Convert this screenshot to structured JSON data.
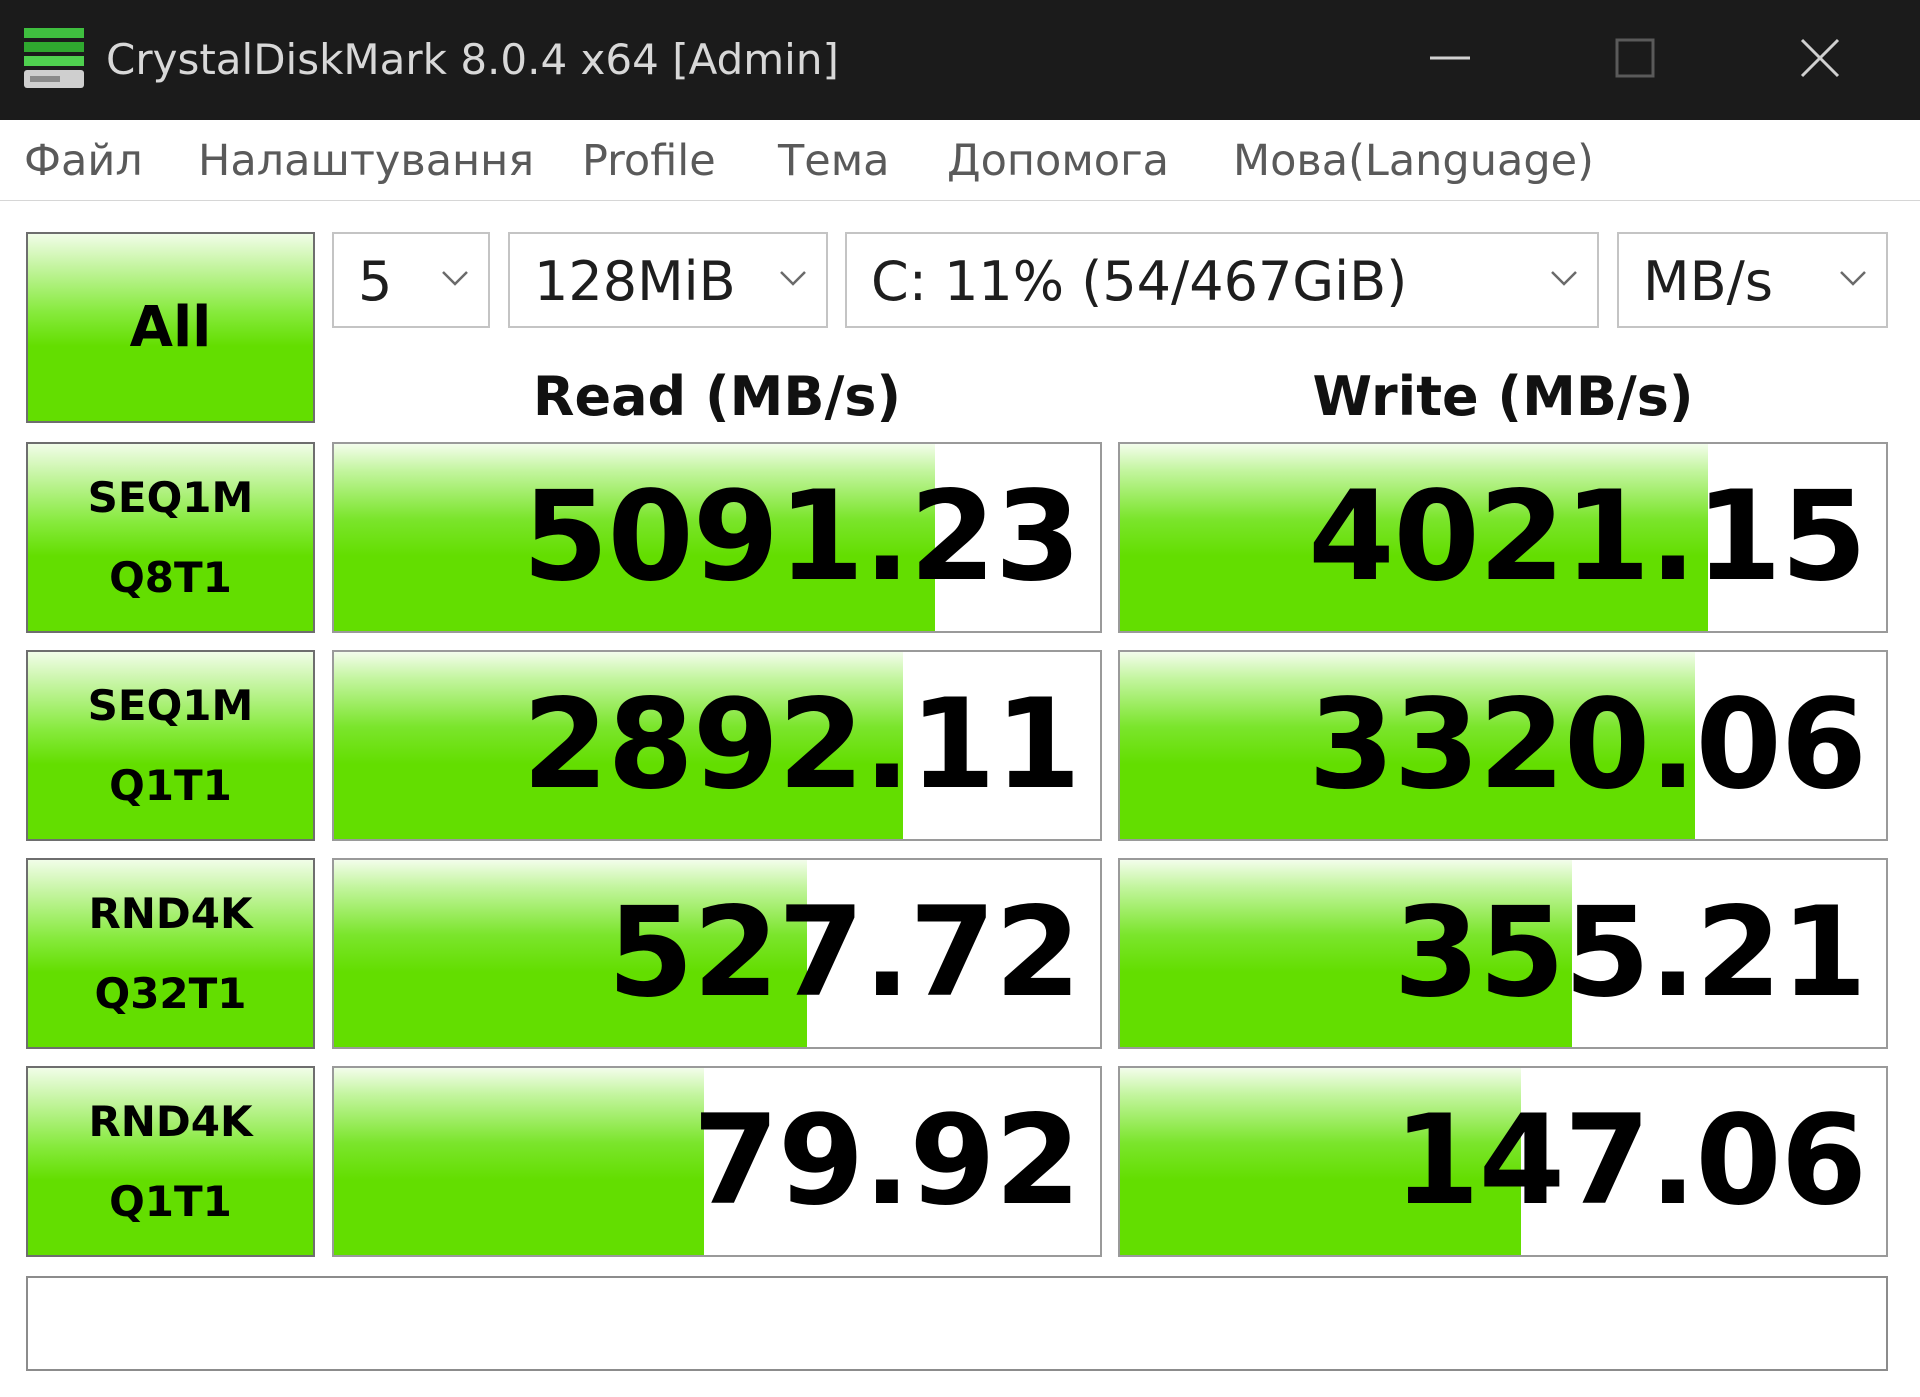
{
  "window": {
    "title": "CrystalDiskMark 8.0.4 x64 [Admin]"
  },
  "menu": [
    "Файл",
    "Налаштування",
    "Profile",
    "Тема",
    "Допомога",
    "Мова(Language)"
  ],
  "controls": {
    "all_label": "All",
    "count": "5",
    "size": "128MiB",
    "drive": "C: 11% (54/467GiB)",
    "unit": "MB/s"
  },
  "headers": {
    "read": "Read (MB/s)",
    "write": "Write (MB/s)"
  },
  "tests": [
    {
      "line1": "SEQ1M",
      "line2": "Q8T1",
      "read": "5091.23",
      "write": "4021.15"
    },
    {
      "line1": "SEQ1M",
      "line2": "Q1T1",
      "read": "2892.11",
      "write": "3320.06"
    },
    {
      "line1": "RND4K",
      "line2": "Q32T1",
      "read": "527.72",
      "write": "355.21"
    },
    {
      "line1": "RND4K",
      "line2": "Q1T1",
      "read": "79.92",
      "write": "147.06"
    }
  ],
  "bar_fill_fraction": [
    {
      "read": 0.785,
      "write": 0.767
    },
    {
      "read": 0.743,
      "write": 0.751
    },
    {
      "read": 0.617,
      "write": 0.59
    },
    {
      "read": 0.483,
      "write": 0.523
    }
  ],
  "comment": "",
  "colors": {
    "bar_green": "#63de00",
    "titlebar": "#1b1b1b"
  },
  "icons": {
    "app": "crystaldiskmark-drive-icon",
    "minimize": "minimize-icon",
    "maximize": "maximize-icon",
    "close": "close-icon",
    "dropdown": "chevron-down-icon"
  }
}
